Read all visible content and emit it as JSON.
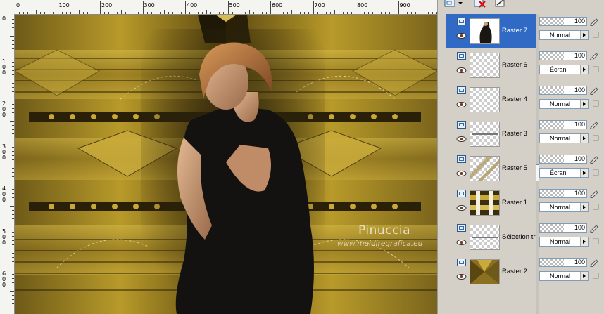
{
  "ruler": {
    "top_labels": [
      "0",
      "100",
      "200",
      "300",
      "400",
      "500",
      "600",
      "700",
      "800",
      "900"
    ],
    "left_labels": [
      "0",
      "100",
      "200",
      "300",
      "400",
      "500",
      "600"
    ]
  },
  "canvas": {
    "watermark_name": "Pinuccia",
    "watermark_url": "www.maidiregrafica.eu"
  },
  "layers_palette": {
    "toolbar": {
      "icons": [
        "new-layer-icon",
        "delete-layer-icon",
        "layer-properties-icon"
      ]
    },
    "layers": [
      {
        "name": "Raster 7",
        "opacity": "100",
        "blend_mode": "Normal",
        "selected": true
      },
      {
        "name": "Raster 6",
        "opacity": "100",
        "blend_mode": "Écran",
        "selected": false
      },
      {
        "name": "Raster 4",
        "opacity": "100",
        "blend_mode": "Normal",
        "selected": false
      },
      {
        "name": "Raster 3",
        "opacity": "100",
        "blend_mode": "Normal",
        "selected": false
      },
      {
        "name": "Raster 5",
        "opacity": "100",
        "blend_mode": "Écran",
        "selected": false
      },
      {
        "name": "Raster 1",
        "opacity": "100",
        "blend_mode": "Normal",
        "selected": false
      },
      {
        "name": "Sélection tr",
        "opacity": "100",
        "blend_mode": "Normal",
        "selected": false
      },
      {
        "name": "Raster 2",
        "opacity": "100",
        "blend_mode": "Normal",
        "selected": false
      }
    ]
  },
  "colors": {
    "selected_row": "#316ac5",
    "panel_bg": "#d4d0c8",
    "gold": "#b89a2a"
  }
}
